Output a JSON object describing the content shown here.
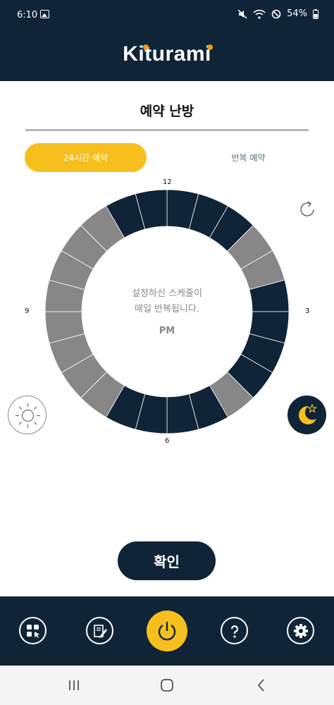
{
  "status_bar": {
    "time": "6:10",
    "battery": "54%",
    "icons": [
      "gallery-icon",
      "mute-icon",
      "wifi-icon",
      "do-not-disturb-icon",
      "battery-icon"
    ]
  },
  "header": {
    "logo": "Kiturami",
    "logo_accent_color": "#f29a1a",
    "background_color": "#0f2437"
  },
  "page": {
    "title": "예약 난방"
  },
  "tabs": [
    {
      "label": "24시간 예약",
      "active": true,
      "color": "#f6bf1d"
    },
    {
      "label": "반복 예약",
      "active": false
    }
  ],
  "schedule": {
    "hour_labels": {
      "top": "12",
      "right": "3",
      "bottom": "6",
      "left": "9"
    },
    "center_message_line1": "설정하신 스케줄이",
    "center_message_line2": "매일 반복됩니다.",
    "period": "PM",
    "segment_states": [
      "on",
      "on",
      "on",
      "off",
      "off",
      "on",
      "on",
      "on",
      "on",
      "off",
      "on",
      "on",
      "on",
      "on",
      "off",
      "off",
      "off",
      "off",
      "off",
      "off",
      "off",
      "off",
      "on",
      "on"
    ],
    "on_color": "#0f2437",
    "off_color": "#878787"
  },
  "mode_buttons": {
    "day": "sun-icon",
    "night": "moon-star-icon"
  },
  "actions": {
    "confirm_label": "확인"
  },
  "bottom_nav": {
    "items": [
      "grid-touch-icon",
      "edit-note-icon",
      "power-icon",
      "help-icon",
      "gear-icon"
    ]
  },
  "system_nav": [
    "recent-apps-icon",
    "home-icon",
    "back-icon"
  ]
}
